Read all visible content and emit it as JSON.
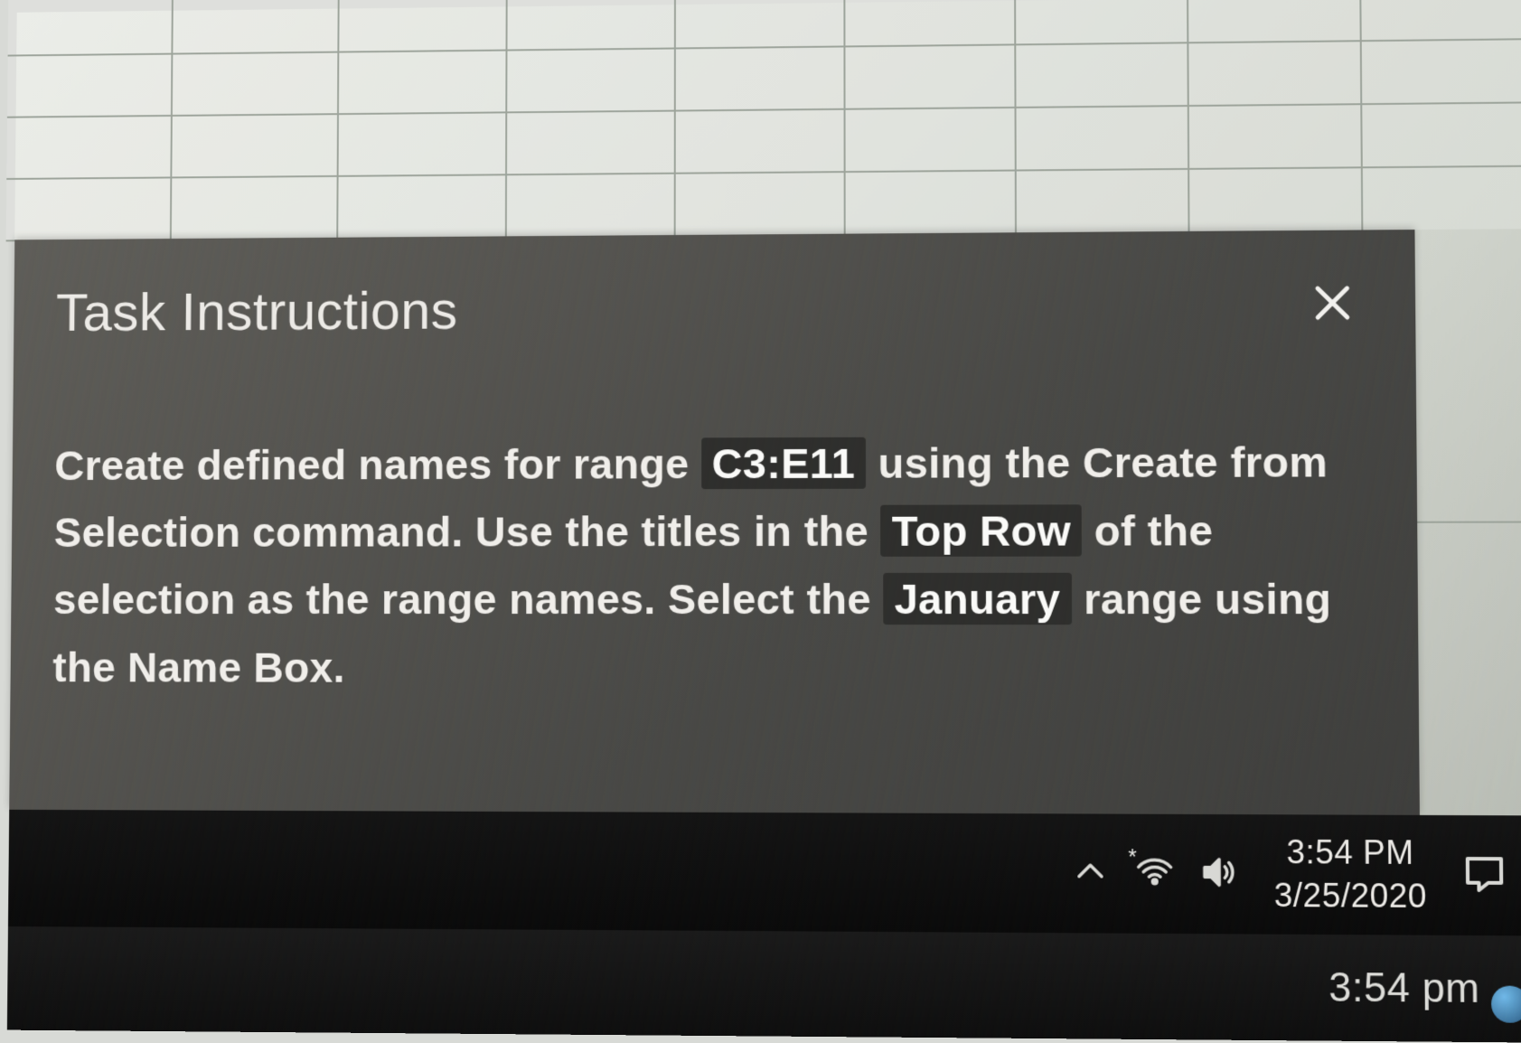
{
  "panel": {
    "title": "Task Instructions",
    "close_label": "Close",
    "body": {
      "t1": "Create defined names for range ",
      "h1": "C3:E11",
      "t2": " using the Create from Selection command. Use the titles in the ",
      "h2": "Top Row",
      "t3": " of the selection as the range names. Select the ",
      "h3": "January",
      "t4": " range using the Name Box."
    }
  },
  "taskbar": {
    "time": "3:54 PM",
    "date": "3/25/2020"
  },
  "bottom": {
    "time": "3:54 pm"
  }
}
